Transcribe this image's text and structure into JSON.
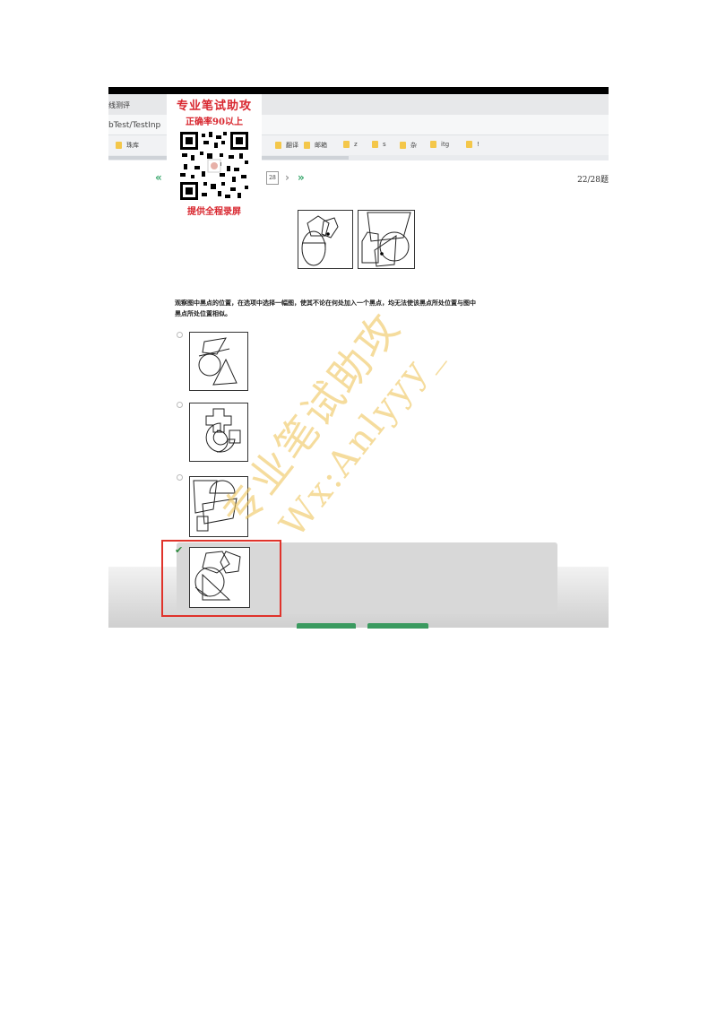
{
  "browser": {
    "tab_title": "…(在线测评)",
    "tab_visible_text": "线测评",
    "address_text": "bTest/TestInp",
    "bookmarks": [
      "珠库",
      "翻译",
      "邮箱",
      "z",
      "s",
      "杂",
      "itg",
      "!"
    ],
    "page_progress": 0.48
  },
  "navigation": {
    "prev_icon": "double-chevron-left-icon",
    "page_number": "28",
    "next_icon": "chevron-right-icon",
    "last_icon": "double-chevron-right-icon",
    "counter": "22/28题"
  },
  "question": {
    "text_line1": "观察图中黑点的位置，在选项中选择一幅图，使其不论在何处加入一个黑点，均无法使该黑点所处位置与图中",
    "text_line2": "黑点所处位置相似。"
  },
  "options": [
    {
      "id": "A",
      "selected": false
    },
    {
      "id": "B",
      "selected": false
    },
    {
      "id": "C",
      "selected": false
    },
    {
      "id": "D",
      "selected": true
    }
  ],
  "overlay_promo": {
    "line1": "专业笔试助攻",
    "line2": "正确率90以上",
    "line3": "提供全程录屏"
  },
  "watermark": {
    "line1": "专业笔试助攻",
    "line2": "Wx:Anlyyy_"
  },
  "colors": {
    "accent_green": "#3aa76d",
    "highlight_red": "#e0332b",
    "promo_red": "#d8262e",
    "watermark_gold": "#eec45c"
  }
}
